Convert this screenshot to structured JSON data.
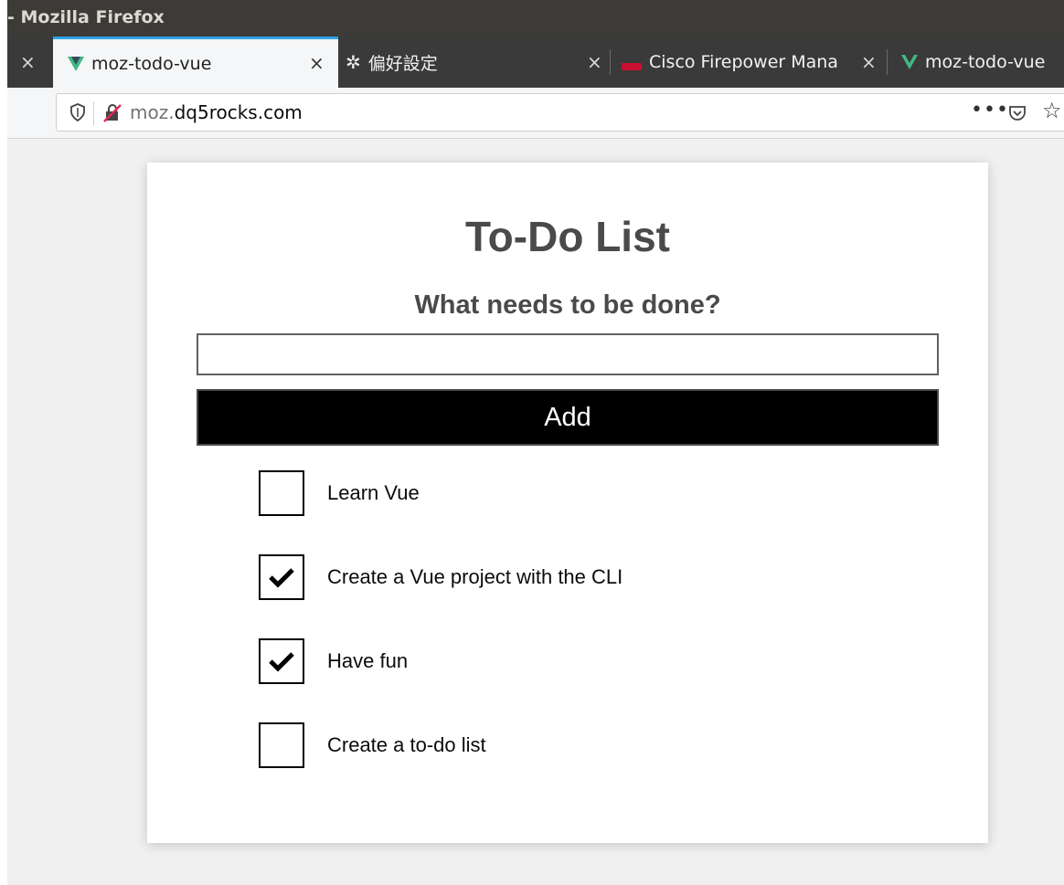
{
  "window": {
    "title": "- Mozilla Firefox"
  },
  "tabs": [
    {
      "label": "moz-todo-vue",
      "icon": "vue-logo-icon",
      "active": true
    },
    {
      "label": "偏好設定",
      "icon": "gear-icon",
      "active": false
    },
    {
      "label": "Cisco Firepower Mana",
      "icon": "cisco-icon",
      "active": false
    },
    {
      "label": "moz-todo-vue",
      "icon": "vue-logo-icon",
      "active": false
    }
  ],
  "urlbar": {
    "url_prefix": "moz.",
    "url_domain": "dq5rocks.com",
    "more_label": "•••"
  },
  "app": {
    "title": "To-Do List",
    "prompt": "What needs to be done?",
    "input_value": "",
    "add_label": "Add",
    "items": [
      {
        "label": "Learn Vue",
        "done": false
      },
      {
        "label": "Create a Vue project with the CLI",
        "done": true
      },
      {
        "label": "Have fun",
        "done": true
      },
      {
        "label": "Create a to-do list",
        "done": false
      }
    ]
  },
  "colors": {
    "titlebar": "#3c3b37",
    "tabstrip": "#3a3a3a",
    "active_tab_accent": "#2fa3e8",
    "vue_green": "#41b883",
    "button_bg": "#000000",
    "page_bg": "#f0f0f0"
  }
}
